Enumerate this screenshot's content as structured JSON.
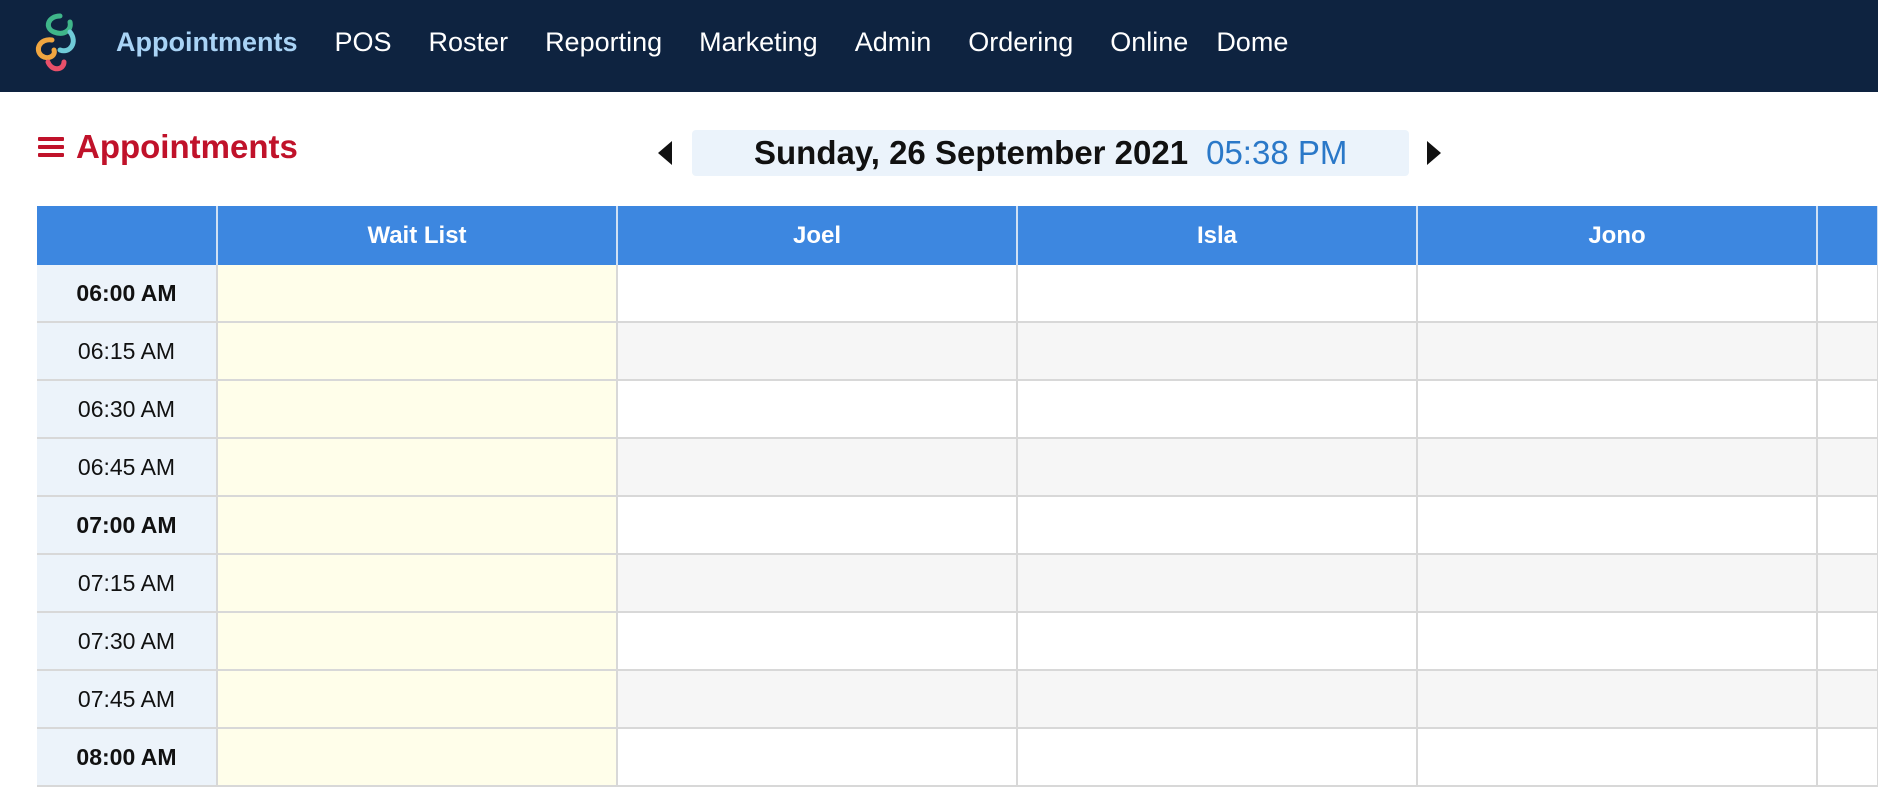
{
  "nav": {
    "items": [
      {
        "label": "Appointments",
        "active": true
      },
      {
        "label": "POS"
      },
      {
        "label": "Roster"
      },
      {
        "label": "Reporting"
      },
      {
        "label": "Marketing"
      },
      {
        "label": "Admin"
      },
      {
        "label": "Ordering"
      },
      {
        "label": "Online"
      },
      {
        "label": "Dome"
      }
    ]
  },
  "page": {
    "title": "Appointments"
  },
  "date_nav": {
    "date": "Sunday, 26 September 2021",
    "time": "05:38 PM"
  },
  "grid": {
    "columns": [
      "",
      "Wait List",
      "Joel",
      "Isla",
      "Jono",
      ""
    ],
    "rows": [
      {
        "time": "06:00 AM",
        "hour": true
      },
      {
        "time": "06:15 AM",
        "hour": false
      },
      {
        "time": "06:30 AM",
        "hour": false
      },
      {
        "time": "06:45 AM",
        "hour": false
      },
      {
        "time": "07:00 AM",
        "hour": true
      },
      {
        "time": "07:15 AM",
        "hour": false
      },
      {
        "time": "07:30 AM",
        "hour": false
      },
      {
        "time": "07:45 AM",
        "hour": false
      },
      {
        "time": "08:00 AM",
        "hour": true
      }
    ]
  },
  "colors": {
    "topbar": "#0e2340",
    "accent_red": "#c0122a",
    "header_blue": "#3d87e0",
    "time_blue": "#2a78c8",
    "waitlist_yellow": "#fffeea"
  },
  "icons": {
    "logo": "swirl-logo-icon",
    "menu": "hamburger-icon",
    "prev": "triangle-left-icon",
    "next": "triangle-right-icon"
  }
}
